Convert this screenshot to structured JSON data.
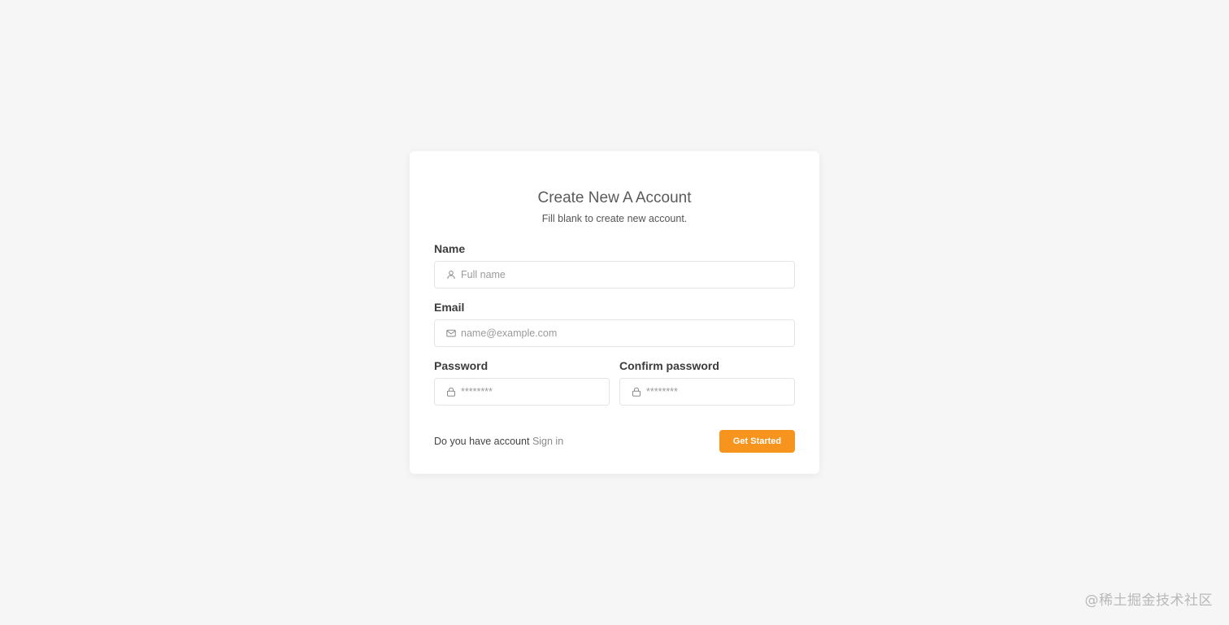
{
  "form": {
    "title": "Create New A Account",
    "subtitle": "Fill blank to create new account.",
    "name": {
      "label": "Name",
      "placeholder": "Full name",
      "value": "",
      "icon": "user-icon"
    },
    "email": {
      "label": "Email",
      "placeholder": "name@example.com",
      "value": "",
      "icon": "mail-icon"
    },
    "password": {
      "label": "Password",
      "placeholder": "********",
      "value": "",
      "icon": "lock-icon"
    },
    "confirm_password": {
      "label": "Confirm password",
      "placeholder": "********",
      "value": "",
      "icon": "lock-icon"
    },
    "footer": {
      "prompt": "Do you have account",
      "signin_link": "Sign in",
      "submit_label": "Get Started"
    }
  },
  "watermark": "@稀土掘金技术社区",
  "colors": {
    "page_background": "#f6f6f6",
    "card_background": "#ffffff",
    "accent": "#f7941d",
    "input_border": "#e4e4e4"
  }
}
